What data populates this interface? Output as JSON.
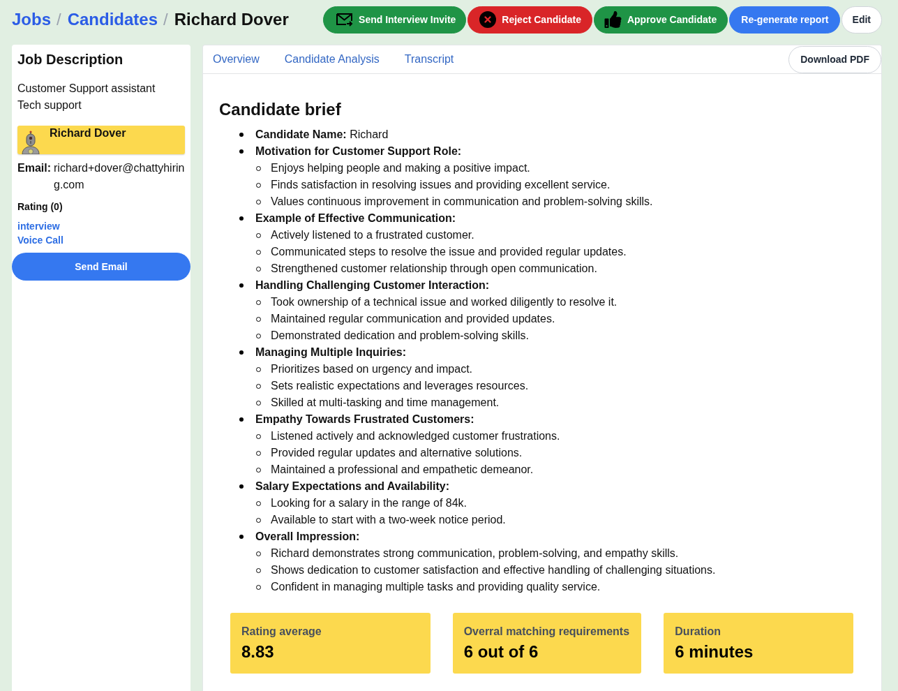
{
  "breadcrumb": [
    {
      "kind": "link",
      "label": "Jobs"
    },
    {
      "kind": "separator",
      "label": "/"
    },
    {
      "kind": "link",
      "label": "Candidates"
    },
    {
      "kind": "separator",
      "label": "/"
    },
    {
      "kind": "current",
      "label": "Richard Dover"
    }
  ],
  "actions": [
    {
      "kind": "invite",
      "label": "Send Interview Invite"
    },
    {
      "kind": "reject",
      "label": "Reject Candidate"
    },
    {
      "kind": "approve",
      "label": "Approve Candidate"
    },
    {
      "kind": "primary",
      "label": "Re-generate report"
    },
    {
      "kind": "plain",
      "label": "Edit"
    }
  ],
  "sidebar": {
    "title": "Job Description",
    "job_lines": [
      "Customer Support assistant",
      "Tech support"
    ],
    "candidate": {
      "name": "Richard Dover"
    },
    "email": {
      "label": "Email:",
      "value": "richard+dover@chattyhiring.com"
    },
    "rating": "Rating (0)",
    "links": [
      "interview",
      "Voice Call"
    ],
    "button": "Send Email"
  },
  "main": {
    "tabs": [
      {
        "label": "Overview",
        "selected": false
      },
      {
        "label": "Candidate Analysis",
        "selected": false
      },
      {
        "label": "Transcript",
        "selected": false
      }
    ],
    "download_button": "Download PDF",
    "brief": {
      "title": "Candidate brief",
      "sections": [
        {
          "label": "Candidate Name:",
          "value": "Richard"
        },
        {
          "label": "Motivation for Customer Support Role:",
          "items": [
            "Enjoys helping people and making a positive impact.",
            "Finds satisfaction in resolving issues and providing excellent service.",
            "Values continuous improvement in communication and problem-solving skills."
          ]
        },
        {
          "label": "Example of Effective Communication:",
          "items": [
            "Actively listened to a frustrated customer.",
            "Communicated steps to resolve the issue and provided regular updates.",
            "Strengthened customer relationship through open communication."
          ]
        },
        {
          "label": "Handling Challenging Customer Interaction:",
          "items": [
            "Took ownership of a technical issue and worked diligently to resolve it.",
            "Maintained regular communication and provided updates.",
            "Demonstrated dedication and problem-solving skills."
          ]
        },
        {
          "label": "Managing Multiple Inquiries:",
          "items": [
            "Prioritizes based on urgency and impact.",
            "Sets realistic expectations and leverages resources.",
            "Skilled at multi-tasking and time management."
          ]
        },
        {
          "label": "Empathy Towards Frustrated Customers:",
          "items": [
            "Listened actively and acknowledged customer frustrations.",
            "Provided regular updates and alternative solutions.",
            "Maintained a professional and empathetic demeanor."
          ]
        },
        {
          "label": "Salary Expectations and Availability:",
          "items": [
            "Looking for a salary in the range of 84k.",
            "Available to start with a two-week notice period."
          ]
        },
        {
          "label": "Overall Impression:",
          "items": [
            "Richard demonstrates strong communication, problem-solving, and empathy skills.",
            "Shows dedication to customer satisfaction and effective handling of challenging situations.",
            "Confident in managing multiple tasks and providing quality service."
          ]
        }
      ]
    },
    "stats": [
      {
        "label": "Rating average",
        "value": "8.83"
      },
      {
        "label": "Overral matching requirements",
        "value": "6 out of 6"
      },
      {
        "label": "Duration",
        "value": "6 minutes"
      }
    ]
  }
}
